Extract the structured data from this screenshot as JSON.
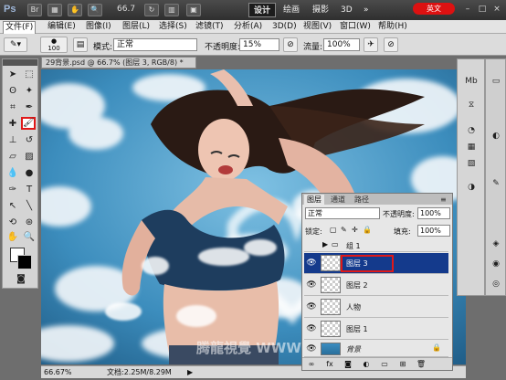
{
  "appbar": {
    "logo": "Ps",
    "zoom": "66.7",
    "workspaces": [
      "设计",
      "绘画",
      "摄影",
      "3D"
    ],
    "lang_badge": "英文",
    "window_controls": [
      "–",
      "□",
      "×"
    ]
  },
  "menu": [
    "文件(F)",
    "编辑(E)",
    "图像(I)",
    "图层(L)",
    "选择(S)",
    "滤镜(T)",
    "分析(A)",
    "3D(D)",
    "视图(V)",
    "窗口(W)",
    "帮助(H)"
  ],
  "options": {
    "brush_size": "100",
    "mode_label": "模式:",
    "mode_value": "正常",
    "opacity_label": "不透明度:",
    "opacity_value": "15%",
    "flow_label": "流量:",
    "flow_value": "100%"
  },
  "document": {
    "tab_title": "29背景.psd @ 66.7% (图层 3, RGB/8) *",
    "watermark": "腾龍視覺 WWW.TLVI.NET"
  },
  "status": {
    "zoom": "66.67%",
    "doc_size": "文档:2.25M/8.29M"
  },
  "layers_panel": {
    "tabs": [
      "图层",
      "通道",
      "路径"
    ],
    "blend_mode": "正常",
    "opacity_label": "不透明度:",
    "opacity_value": "100%",
    "lock_label": "锁定:",
    "fill_label": "填充:",
    "fill_value": "100%",
    "layers": [
      {
        "name": "组 1",
        "visible": false
      },
      {
        "name": "图层 3",
        "visible": true,
        "selected": true
      },
      {
        "name": "图层 2",
        "visible": true
      },
      {
        "name": "人物",
        "visible": true
      },
      {
        "name": "图层 1",
        "visible": true
      },
      {
        "name": "背景",
        "visible": true
      }
    ]
  },
  "colors": {
    "selection_highlight": "#e01818",
    "selected_layer": "#143a8c"
  }
}
